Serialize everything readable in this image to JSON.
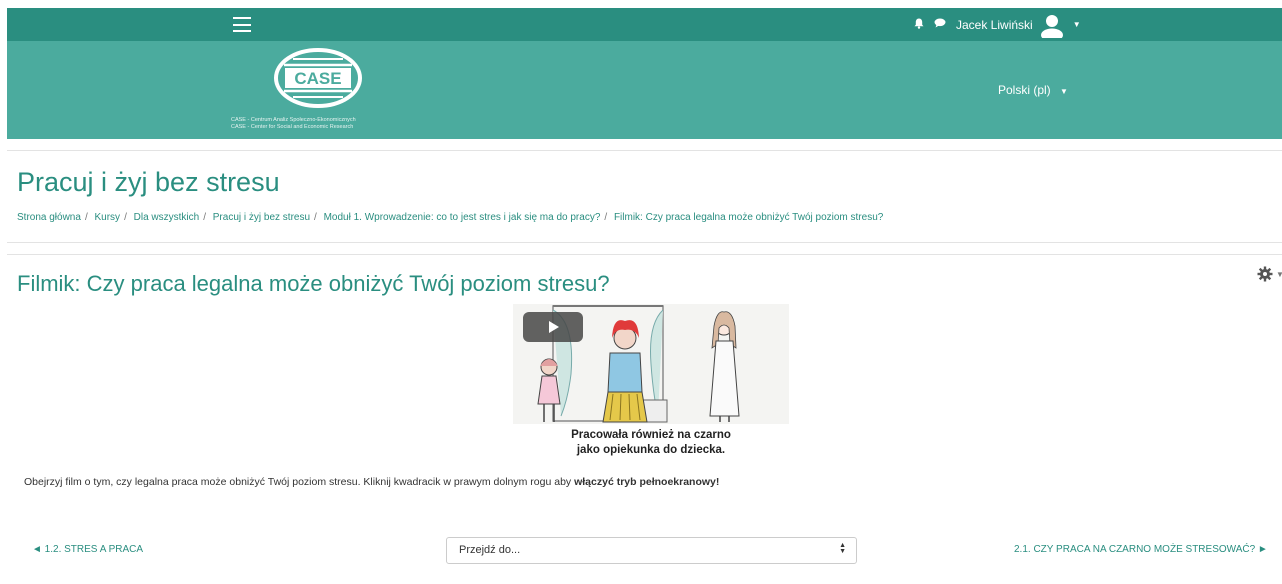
{
  "topbar": {
    "user_name": "Jacek Liwiński",
    "icons": [
      "menu-icon",
      "bell-icon",
      "chat-icon",
      "user-avatar-icon",
      "caret-down-icon"
    ]
  },
  "brand": {
    "logo_text": "CASE",
    "line1": "CASE - Centrum Analiz Społeczno-Ekonomicznych",
    "line2": "CASE - Center for Social and Economic Research",
    "language": "Polski (pl)"
  },
  "page": {
    "title": "Pracuj i żyj bez stresu",
    "breadcrumb": [
      "Strona główna",
      "Kursy",
      "Dla wszystkich",
      "Pracuj i żyj bez stresu",
      "Moduł 1. Wprowadzenie: co to jest stres i jak się ma do pracy?",
      "Filmik: Czy praca legalna może obniżyć Twój poziom stresu?"
    ]
  },
  "activity": {
    "title": "Filmik: Czy praca legalna może obniżyć Twój poziom stresu?",
    "video_caption_line1": "Pracowała również na czarno",
    "video_caption_line2": "jako opiekunka do dziecka.",
    "description_plain": "Obejrzyj film o tym, czy legalna praca może obniżyć Twój poziom stresu. Kliknij kwadracik w prawym dolnym rogu aby ",
    "description_bold": "włączyć tryb pełnoekranowy!"
  },
  "navigation": {
    "prev": "◄ 1.2. STRES A PRACA",
    "jump_placeholder": "Przejdź do...",
    "next": "2.1. CZY PRACA NA CZARNO MOŻE STRESOWAĆ? ►"
  },
  "colors": {
    "topbar": "#2a8e80",
    "brandbar": "#4bab9e",
    "accent_text": "#2a8e80"
  }
}
